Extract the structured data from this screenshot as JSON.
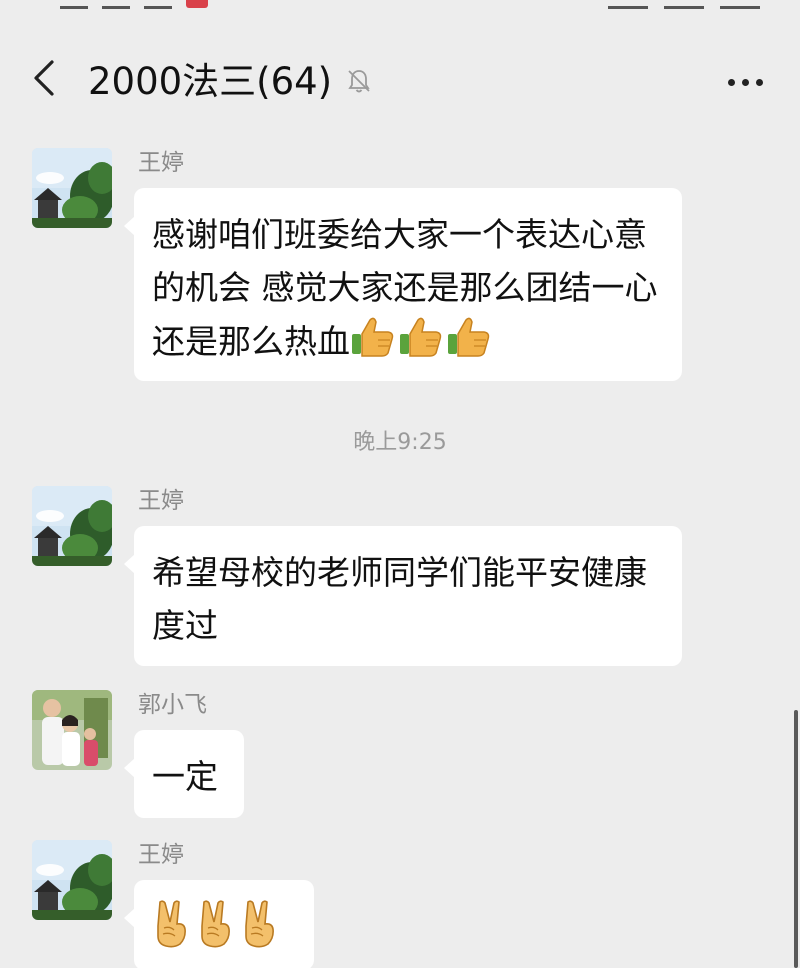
{
  "header": {
    "title": "2000法三(64)",
    "back_icon": "chevron-left-icon",
    "mute_icon": "bell-muted-icon",
    "more_icon": "more-dots-icon"
  },
  "messages": [
    {
      "sender": "王婷",
      "avatar": "avatar-landscape",
      "text": "感谢咱们班委给大家一个表达心意的机会 感觉大家还是那么团结一心 还是那么热血",
      "emoji": [
        "thumbs-up",
        "thumbs-up",
        "thumbs-up"
      ]
    },
    {
      "timestamp": "晚上9:25"
    },
    {
      "sender": "王婷",
      "avatar": "avatar-landscape",
      "text": "希望母校的老师同学们能平安健康度过"
    },
    {
      "sender": "郭小飞",
      "avatar": "avatar-family",
      "text": "一定"
    },
    {
      "sender": "王婷",
      "avatar": "avatar-landscape",
      "text": "",
      "emoji": [
        "victory-hand",
        "victory-hand",
        "victory-hand"
      ]
    }
  ],
  "colors": {
    "background": "#ededed",
    "bubble": "#ffffff",
    "sender_name": "#8a8a8a",
    "timestamp": "#9a9a9a"
  }
}
